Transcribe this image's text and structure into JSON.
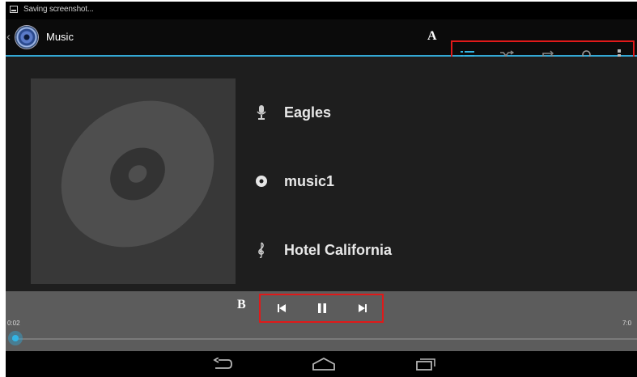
{
  "status_bar": {
    "notification_icon": "screenshot-icon",
    "text": "Saving screenshot..."
  },
  "action_bar": {
    "app_icon": "music-app-icon",
    "title": "Music",
    "accent_color": "#33a7d4",
    "actions": [
      {
        "name": "now-playing-list",
        "icon": "list-icon"
      },
      {
        "name": "shuffle",
        "icon": "shuffle-icon"
      },
      {
        "name": "repeat",
        "icon": "repeat-icon"
      },
      {
        "name": "search",
        "icon": "search-icon"
      },
      {
        "name": "overflow-menu",
        "icon": "more-vertical-icon"
      }
    ]
  },
  "annotations": {
    "a": "A",
    "b": "B",
    "highlight_color": "#e01919"
  },
  "track": {
    "album_art": "disc-placeholder-art",
    "artist": "Eagles",
    "album": "music1",
    "song": "Hotel California"
  },
  "player": {
    "elapsed": "0:02",
    "total": "7:0",
    "progress_fraction": 0.005,
    "controls": [
      {
        "name": "previous",
        "icon": "skip-previous-icon"
      },
      {
        "name": "pause",
        "icon": "pause-icon"
      },
      {
        "name": "next",
        "icon": "skip-next-icon"
      }
    ]
  },
  "nav_bar": {
    "buttons": [
      "back-icon",
      "home-icon",
      "recent-apps-icon"
    ]
  }
}
